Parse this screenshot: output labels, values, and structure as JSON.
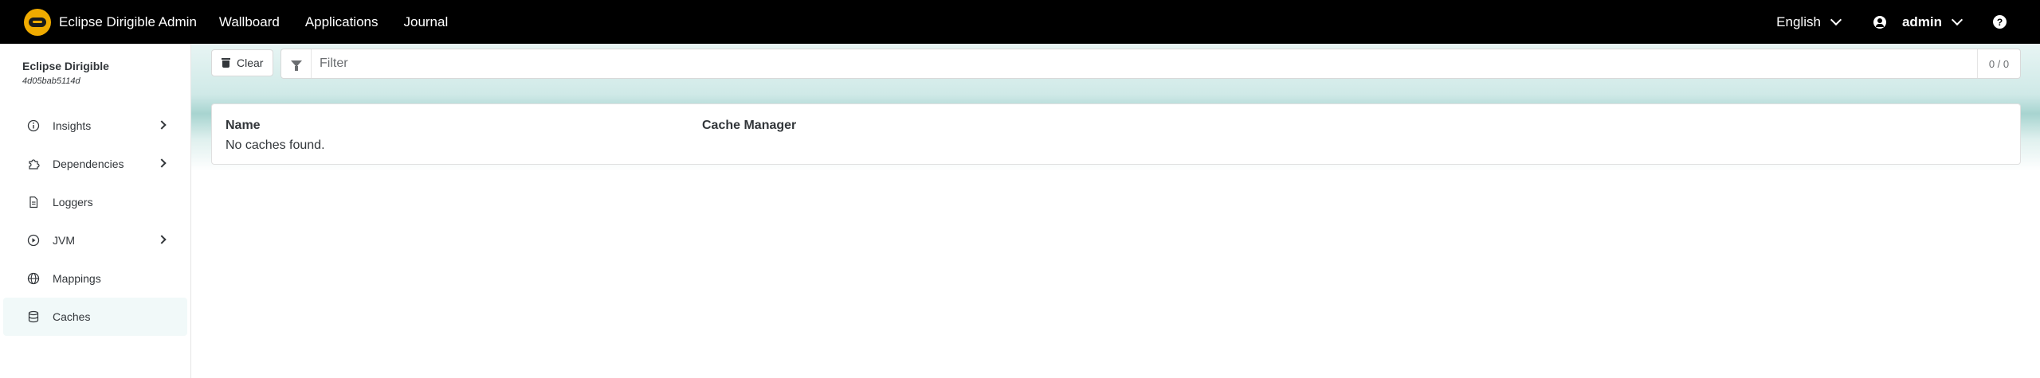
{
  "navbar": {
    "brand": "Eclipse Dirigible Admin",
    "links": [
      "Wallboard",
      "Applications",
      "Journal"
    ],
    "language": "English",
    "user": "admin"
  },
  "sidebar": {
    "title": "Eclipse Dirigible",
    "subtitle": "4d05bab5114d",
    "items": [
      {
        "label": "Insights",
        "icon": "info-icon",
        "has_children": true
      },
      {
        "label": "Dependencies",
        "icon": "puzzle-icon",
        "has_children": true
      },
      {
        "label": "Loggers",
        "icon": "document-icon",
        "has_children": false
      },
      {
        "label": "JVM",
        "icon": "play-circle-icon",
        "has_children": true
      },
      {
        "label": "Mappings",
        "icon": "globe-icon",
        "has_children": false
      },
      {
        "label": "Caches",
        "icon": "database-icon",
        "has_children": false,
        "active": true
      }
    ]
  },
  "toolbar": {
    "clear_label": "Clear",
    "filter_placeholder": "Filter",
    "count": "0 / 0"
  },
  "table": {
    "columns": [
      "Name",
      "Cache Manager"
    ],
    "empty_message": "No caches found."
  },
  "colors": {
    "navbar_bg": "#000000",
    "logo": "#f0ab00",
    "band": "#a7d4d0",
    "active_item_bg": "#f1f9f9"
  }
}
